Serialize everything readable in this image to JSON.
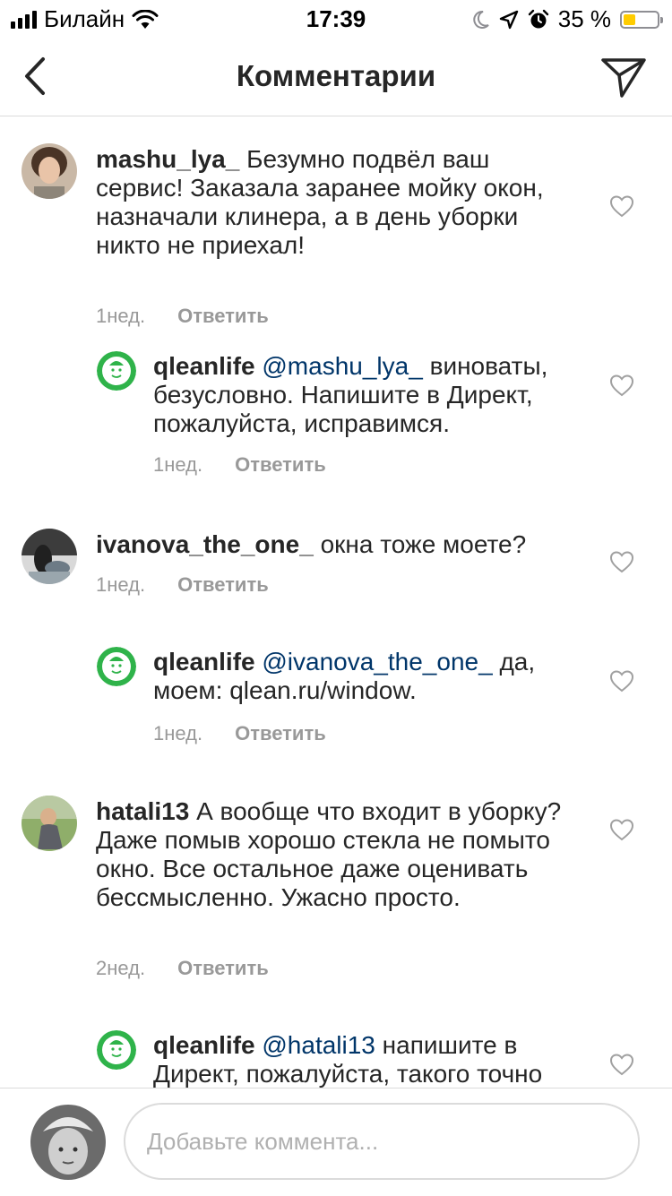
{
  "status_bar": {
    "carrier": "Билайн",
    "time": "17:39",
    "battery_percent": "35 %",
    "battery_level": 0.35,
    "icons": [
      "signal-icon",
      "wifi-icon",
      "moon-icon",
      "location-icon",
      "alarm-icon",
      "battery-icon"
    ]
  },
  "nav": {
    "title": "Комментарии",
    "back_icon": "chevron-left-icon",
    "share_icon": "paper-plane-icon"
  },
  "comments": [
    {
      "username": "mashu_lya_",
      "mention": "",
      "text": "Безумно подвёл ваш сервис! Заказала заранее мойку окон, назначали клинера, а в день уборки никто не приехал!",
      "time": "1нед.",
      "reply_label": "Ответить"
    },
    {
      "username": "qleanlife",
      "mention": "@mashu_lya_",
      "text": "виноваты, безусловно. Напишите в Директ, пожалуйста, исправимся.",
      "time": "1нед.",
      "reply_label": "Ответить"
    },
    {
      "username": "ivanova_the_one_",
      "mention": "",
      "text": "окна тоже моете?",
      "time": "1нед.",
      "reply_label": "Ответить"
    },
    {
      "username": "qleanlife",
      "mention": "@ivanova_the_one_",
      "text": "да, моем: qlean.ru/window.",
      "time": "1нед.",
      "reply_label": "Ответить"
    },
    {
      "username": "hatali13",
      "mention": "",
      "text": "А вообще что входит в уборку? Даже помыв хорошо стекла не помыто окно. Все остальное даже оценивать бессмысленно. Ужасно просто.",
      "time": "2нед.",
      "reply_label": "Ответить"
    },
    {
      "username": "qleanlife",
      "mention": "@hatali13",
      "text": "напишите в Директ, пожалуйста, такого точно",
      "time": "",
      "reply_label": ""
    }
  ],
  "input": {
    "placeholder": "Добавьте коммента..."
  },
  "colors": {
    "mention": "#003569",
    "brand_green": "#2fb34a",
    "meta_gray": "#999999",
    "battery_yellow": "#ffcc00"
  }
}
